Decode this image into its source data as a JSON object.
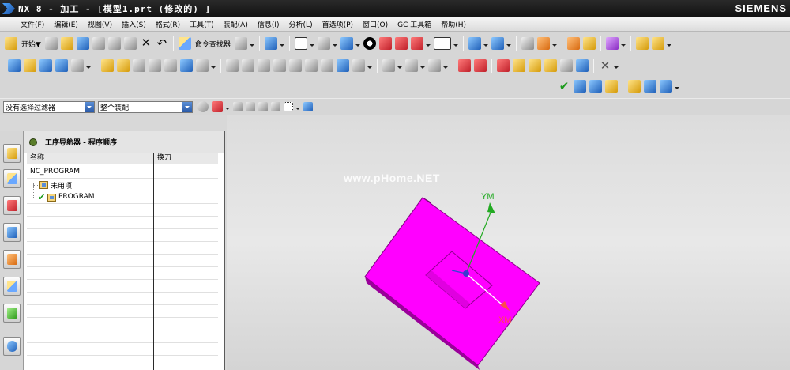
{
  "window": {
    "title": "NX 8 - 加工 - [模型1.prt  (修改的) ]",
    "brand": "SIEMENS"
  },
  "menubar": {
    "items": [
      "文件(F)",
      "编辑(E)",
      "视图(V)",
      "插入(S)",
      "格式(R)",
      "工具(T)",
      "装配(A)",
      "信息(I)",
      "分析(L)",
      "首选项(P)",
      "窗口(O)",
      "GC 工具箱",
      "帮助(H)"
    ]
  },
  "toolbar": {
    "start_label": "开始▼",
    "command_finder_label": "命令查找器"
  },
  "selection_bar": {
    "filter_value": "没有选择过滤器",
    "scope_value": "整个装配"
  },
  "navigator": {
    "title": "工序导航器 - 程序顺序",
    "columns": [
      "名称",
      "换刀"
    ],
    "rows": [
      {
        "name": "NC_PROGRAM",
        "tool_change": ""
      },
      {
        "name": "未用项",
        "tool_change": ""
      },
      {
        "name": "PROGRAM",
        "tool_change": ""
      }
    ]
  },
  "viewport": {
    "axis_y_label": "YM",
    "axis_x_label": "XM",
    "watermark": "www.pHome.NET",
    "part_color": "#ff00ff"
  },
  "resource_bar": {
    "icons": [
      "part-navigator-icon",
      "assembly-navigator-icon",
      "constraint-navigator-icon",
      "operation-navigator-icon",
      "machine-tool-navigator-icon",
      "reuse-library-icon",
      "history-icon",
      "web-browser-icon"
    ]
  }
}
